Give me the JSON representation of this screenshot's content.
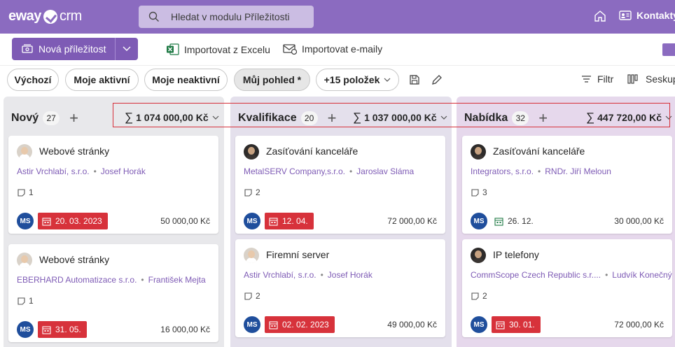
{
  "brand": {
    "name": "eway",
    "suffix": "crm"
  },
  "search": {
    "placeholder": "Hledat v modulu Příležitosti"
  },
  "nav": {
    "kontakty": "Kontakty"
  },
  "actions": {
    "new_opportunity": "Nová příležitost",
    "import_excel": "Importovat z Excelu",
    "import_email": "Importovat e-maily"
  },
  "filters": {
    "views": [
      "Výchozí",
      "Moje aktivní",
      "Moje neaktivní",
      "Můj pohled *"
    ],
    "more": "+15 položek",
    "filter": "Filtr",
    "group": "Seskup"
  },
  "columns": [
    {
      "title": "Nový",
      "count": "27",
      "sum": "1 074 000,00 Kč",
      "cards": [
        {
          "title": "Webové stránky",
          "company": "Astir Vrchlabí, s.r.o.",
          "person": "Josef Horák",
          "notes": "1",
          "owner": "MS",
          "date": "20. 03. 2023",
          "overdue": true,
          "price": "50 000,00 Kč"
        },
        {
          "title": "Webové stránky",
          "company": "EBERHARD Automatizace s.r.o.",
          "person": "František Mejta",
          "notes": "1",
          "owner": "MS",
          "date": "31. 05.",
          "overdue": true,
          "price": "16 000,00 Kč"
        }
      ]
    },
    {
      "title": "Kvalifikace",
      "count": "20",
      "sum": "1 037 000,00 Kč",
      "cards": [
        {
          "title": "Zasíťování kanceláře",
          "company": "MetalSERV Company,s.r.o.",
          "person": "Jaroslav Sláma",
          "notes": "2",
          "owner": "MS",
          "date": "12. 04.",
          "overdue": true,
          "price": "72 000,00 Kč"
        },
        {
          "title": "Firemní server",
          "company": "Astir Vrchlabí, s.r.o.",
          "person": "Josef Horák",
          "notes": "2",
          "owner": "MS",
          "date": "02. 02. 2023",
          "overdue": true,
          "price": "49 000,00 Kč"
        }
      ]
    },
    {
      "title": "Nabídka",
      "count": "32",
      "sum": "447 720,00 Kč",
      "cards": [
        {
          "title": "Zasíťování kanceláře",
          "company": "Integrators, s.r.o.",
          "person": "RNDr. Jiří Meloun",
          "notes": "3",
          "owner": "MS",
          "date": "26. 12.",
          "overdue": false,
          "price": "30 000,00 Kč"
        },
        {
          "title": "IP telefony",
          "company": "CommScope Czech Republic s.r....",
          "person": "Ludvík Konečný",
          "notes": "2",
          "owner": "MS",
          "date": "30. 01.",
          "overdue": true,
          "price": "72 000,00 Kč"
        }
      ]
    }
  ],
  "colors": {
    "brand": "#8b6bc0",
    "button": "#7e5bb5",
    "overdue": "#d7323b",
    "owner": "#1f4e9c"
  }
}
